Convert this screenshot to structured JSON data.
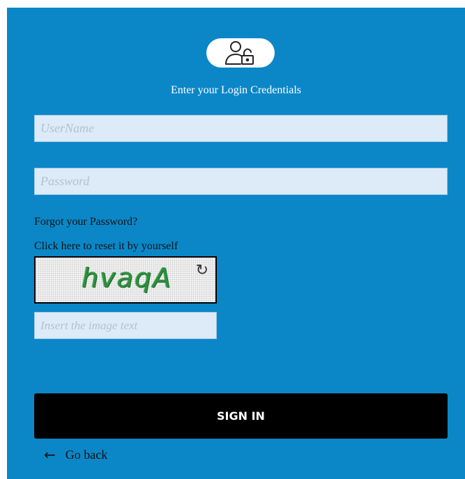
{
  "header": {
    "icon": "user-lock-icon",
    "subtitle": "Enter your Login Credentials"
  },
  "form": {
    "username_placeholder": "UserName",
    "username_value": "",
    "password_placeholder": "Password",
    "password_value": "",
    "forgot_link": "Forgot your Password?",
    "reset_link": "Click here to reset it by yourself",
    "captcha_text": "hvaqA",
    "refresh_icon": "refresh-icon",
    "captcha_placeholder": "Insert the image text",
    "captcha_value": "",
    "submit_label": "SIGN IN",
    "back_label": "Go back",
    "back_icon": "arrow-left-icon"
  },
  "colors": {
    "panel": "#0b87c8",
    "button": "#000000",
    "captcha_text": "#2e8f3f"
  }
}
